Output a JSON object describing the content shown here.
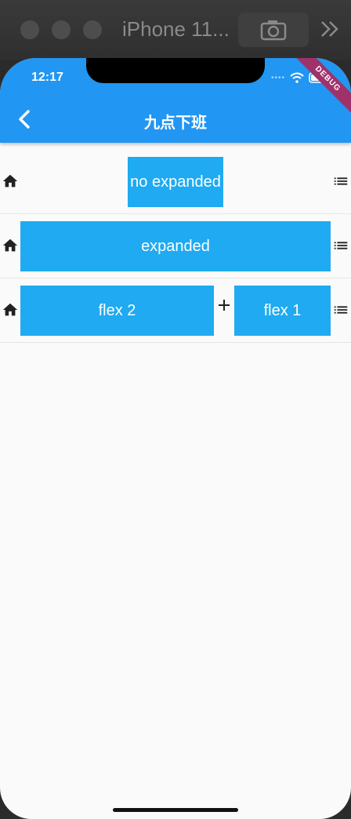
{
  "simulator": {
    "title": "iPhone 11..."
  },
  "status": {
    "time": "12:17",
    "debug": "DEBUG"
  },
  "appbar": {
    "title": "九点下班"
  },
  "rows": [
    {
      "boxes": [
        "no expanded"
      ]
    },
    {
      "boxes": [
        "expanded"
      ]
    },
    {
      "boxes": [
        "flex 2",
        "flex 1"
      ]
    }
  ],
  "colors": {
    "appbar": "#2196f3",
    "box": "#1faaf1",
    "background": "#fafafa"
  }
}
